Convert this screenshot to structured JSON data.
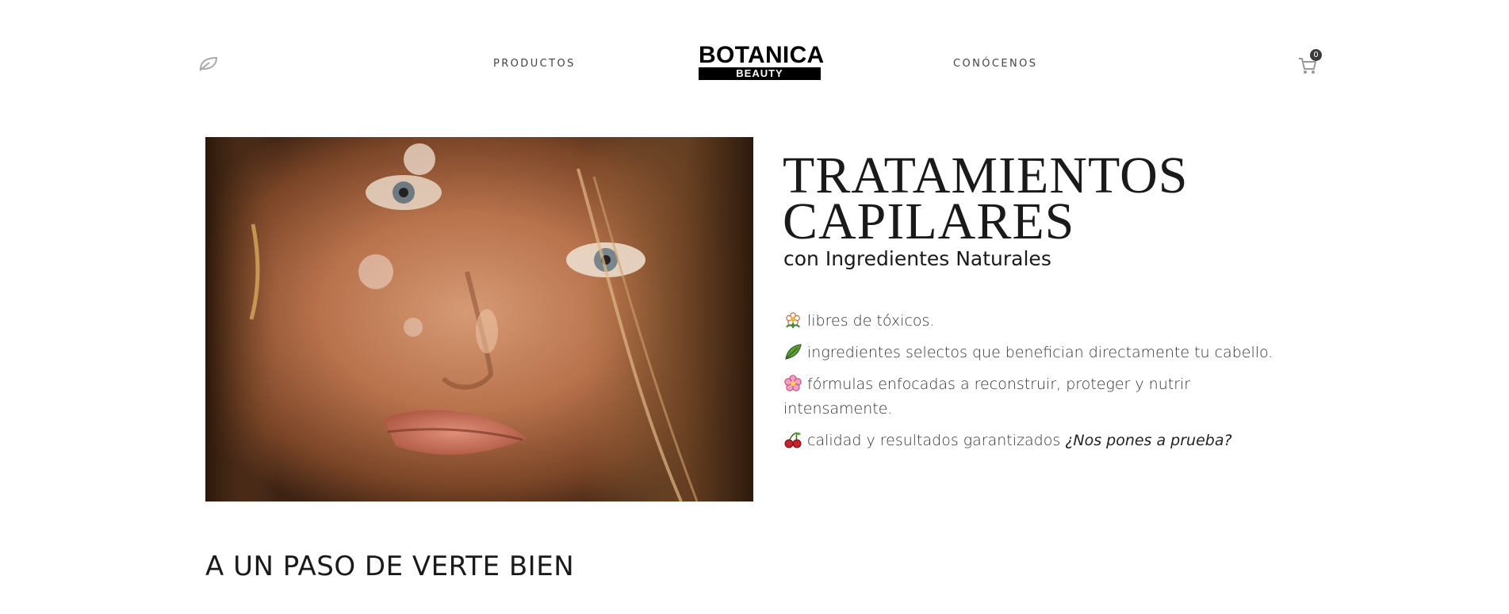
{
  "header": {
    "leaf_icon": "leaf-icon",
    "nav_products": "PRODUCTOS",
    "nav_about": "CONÓCENOS",
    "logo_top": "BOTANICA",
    "logo_bottom": "BEAUTY",
    "cart_icon": "cart-icon",
    "cart_count": "0"
  },
  "hero": {
    "image": "portrait of a woman with freckles",
    "title_line1": "TRATAMIENTOS",
    "title_line2": "CAPILARES",
    "subtitle": "con Ingredientes Naturales",
    "features": [
      {
        "icon": "daisy-icon",
        "text": "libres de tóxicos."
      },
      {
        "icon": "leaf-emoji-icon",
        "text": "ingredientes selectos que benefician directamente tu cabello."
      },
      {
        "icon": "pink-flower-icon",
        "text": "fórmulas enfocadas a reconstruir, proteger y nutrir intensamente."
      },
      {
        "icon": "cherries-icon",
        "text": "calidad y resultados garantizados",
        "emphasis": "¿Nos pones a prueba?"
      }
    ]
  },
  "section": {
    "title": "A UN PASO DE VERTE BIEN"
  },
  "colors": {
    "text": "#1a1a1a",
    "muted": "#444444",
    "badge": "#3a3a3a"
  }
}
